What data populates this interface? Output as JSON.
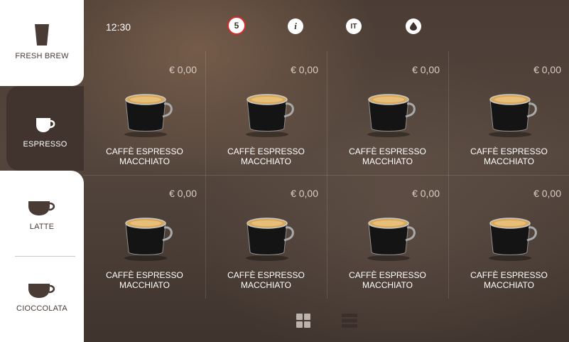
{
  "sidebar": {
    "items": [
      {
        "label": "FRESH BREW",
        "icon": "tall-glass-icon"
      },
      {
        "label": "ESPRESSO",
        "icon": "espresso-cup-icon",
        "active": true
      },
      {
        "label": "LATTE",
        "icon": "latte-cup-icon"
      },
      {
        "label": "CIOCCOLATA",
        "icon": "chocolate-cup-icon"
      }
    ]
  },
  "topbar": {
    "time": "12:30",
    "badge_count": "5",
    "info_label": "i",
    "language": "IT",
    "water_icon": "water-drop-icon",
    "badge_color": "#d62d2d"
  },
  "products": [
    {
      "price": "€ 0,00",
      "name_line1": "CAFFÈ ESPRESSO",
      "name_line2": "MACCHIATO"
    },
    {
      "price": "€ 0,00",
      "name_line1": "CAFFÈ ESPRESSO",
      "name_line2": "MACCHIATO"
    },
    {
      "price": "€ 0,00",
      "name_line1": "CAFFÈ ESPRESSO",
      "name_line2": "MACCHIATO"
    },
    {
      "price": "€ 0,00",
      "name_line1": "CAFFÈ ESPRESSO",
      "name_line2": "MACCHIATO"
    },
    {
      "price": "€ 0,00",
      "name_line1": "CAFFÈ ESPRESSO",
      "name_line2": "MACCHIATO"
    },
    {
      "price": "€ 0,00",
      "name_line1": "CAFFÈ ESPRESSO",
      "name_line2": "MACCHIATO"
    },
    {
      "price": "€ 0,00",
      "name_line1": "CAFFÈ ESPRESSO",
      "name_line2": "MACCHIATO"
    },
    {
      "price": "€ 0,00",
      "name_line1": "CAFFÈ ESPRESSO",
      "name_line2": "MACCHIATO"
    }
  ],
  "bottombar": {
    "grid_view_icon": "grid-view-icon",
    "list_view_icon": "list-view-icon"
  },
  "colors": {
    "sidebar_active": "#41342f",
    "sidebar_text": "#4a3c35",
    "price_text": "#d8cdc6"
  }
}
